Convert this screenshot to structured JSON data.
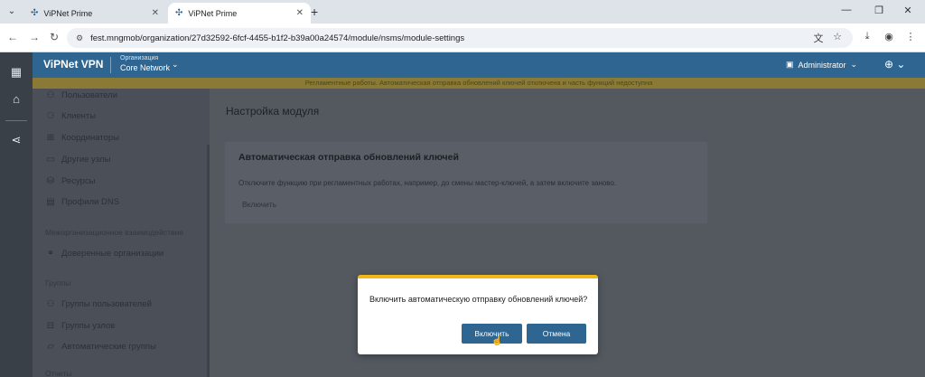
{
  "browser": {
    "tabs": [
      {
        "title": "ViPNet Prime"
      },
      {
        "title": "ViPNet Prime"
      }
    ],
    "new_tab_icon": "plus-icon",
    "url": "fest.mngmob/organization/27d32592-6fcf-4455-b1f2-b39a00a24574/module/nsms/module-settings"
  },
  "header": {
    "brand": "ViPNet VPN",
    "org_label": "Организация",
    "org_name": "Core Network",
    "user": "Administrator"
  },
  "notice": "Регламентные работы. Автоматическая отправка обновлений ключей отключена и часть функций недоступна",
  "sidebar": {
    "items_top": [
      {
        "label": "Пользователи",
        "icon": "user-icon"
      },
      {
        "label": "Клиенты",
        "icon": "clients-icon"
      },
      {
        "label": "Координаторы",
        "icon": "coordinators-icon"
      },
      {
        "label": "Другие узлы",
        "icon": "nodes-icon"
      },
      {
        "label": "Ресурсы",
        "icon": "resources-icon"
      },
      {
        "label": "Профили DNS",
        "icon": "dns-icon"
      }
    ],
    "section_inter": "Межорганизационное взаимодействие",
    "item_trusted": "Доверенные организации",
    "section_groups": "Группы",
    "items_groups": [
      {
        "label": "Группы пользователей",
        "icon": "user-group-icon"
      },
      {
        "label": "Группы узлов",
        "icon": "node-group-icon"
      },
      {
        "label": "Автоматические группы",
        "icon": "folder-icon"
      }
    ],
    "section_bottom": "Отчеты"
  },
  "main": {
    "title": "Настройка модуля",
    "card": {
      "title": "Автоматическая отправка обновлений ключей",
      "description": "Отключите функцию при регламентных работах, например, до смены мастер-ключей, а затем включите заново.",
      "button": "Включить"
    }
  },
  "modal": {
    "question": "Включить автоматическую отправку обновлений ключей?",
    "confirm": "Включить",
    "cancel": "Отмена"
  },
  "colors": {
    "header": "#2e6591",
    "accent": "#f0b716",
    "button": "#2e6591"
  }
}
